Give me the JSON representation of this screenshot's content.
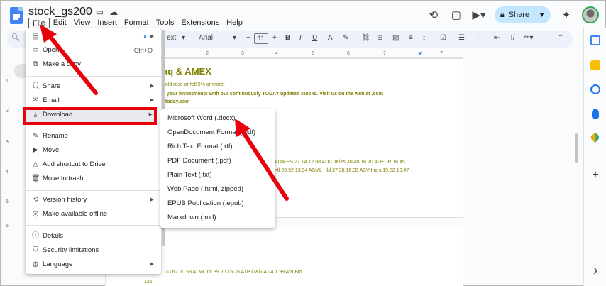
{
  "app": {
    "doc_title": "stock_gs200",
    "menus": [
      "File",
      "Edit",
      "View",
      "Insert",
      "Format",
      "Tools",
      "Extensions",
      "Help"
    ],
    "share_label": "Share"
  },
  "toolbar": {
    "style_label": "ext",
    "font_label": "Arial",
    "font_size": "11"
  },
  "ruler": {
    "numbers": [
      "1",
      "2",
      "3",
      "4",
      "5",
      "6",
      "7"
    ]
  },
  "vruler": {
    "numbers": [
      "1",
      "2",
      "3",
      "4",
      "5",
      "6",
      "7",
      "8",
      "9",
      "10"
    ]
  },
  "document": {
    "heading": "aq & AMEX",
    "line1": "bold rose or fell 5% or more.",
    "line2": "k your investments with our continuously TODAY updated stocks. Visit us on the web at .com",
    "line3": "atoday.com",
    "line4": "ADA-ES 27.14 12.88 ADC Tel rs 30.40 16.70 ADECP 16.45",
    "line5": "ntl 20.92 13.94 ASML Hld 27.38 16.39 ASV Inc s 19.82 10.47",
    "line6": "33.62 20.53 ATMI Inc 39.20 16.76 ATP O&G 4.24 1.99 AVI Bio",
    "page_number": "126"
  },
  "file_menu": {
    "items": [
      {
        "icon": "doc-icon",
        "label": "",
        "shortcut": "",
        "arrow": true
      },
      {
        "icon": "folder-open-icon",
        "label": "Open",
        "shortcut": "Ctrl+O",
        "arrow": false
      },
      {
        "icon": "copy-icon",
        "label": "Make a copy",
        "shortcut": "",
        "arrow": false
      },
      {
        "icon": "person-add-icon",
        "label": "Share",
        "shortcut": "",
        "arrow": true
      },
      {
        "icon": "mail-icon",
        "label": "Email",
        "shortcut": "",
        "arrow": true
      },
      {
        "icon": "download-icon",
        "label": "Download",
        "shortcut": "",
        "arrow": true
      },
      {
        "icon": "rename-icon",
        "label": "Rename",
        "shortcut": "",
        "arrow": false
      },
      {
        "icon": "move-icon",
        "label": "Move",
        "shortcut": "",
        "arrow": false
      },
      {
        "icon": "drive-shortcut-icon",
        "label": "Add shortcut to Drive",
        "shortcut": "",
        "arrow": false
      },
      {
        "icon": "trash-icon",
        "label": "Move to trash",
        "shortcut": "",
        "arrow": false
      },
      {
        "icon": "history-icon",
        "label": "Version history",
        "shortcut": "",
        "arrow": true
      },
      {
        "icon": "offline-icon",
        "label": "Make available offline",
        "shortcut": "",
        "arrow": false
      },
      {
        "icon": "info-icon",
        "label": "Details",
        "shortcut": "",
        "arrow": false
      },
      {
        "icon": "shield-icon",
        "label": "Security limitations",
        "shortcut": "",
        "arrow": false
      },
      {
        "icon": "globe-icon",
        "label": "Language",
        "shortcut": "",
        "arrow": true
      }
    ]
  },
  "download_menu": {
    "items": [
      "Microsoft Word (.docx)",
      "OpenDocument Format (.odt)",
      "Rich Text Format (.rtf)",
      "PDF Document (.pdf)",
      "Plain Text (.txt)",
      "Web Page (.html, zipped)",
      "EPUB Publication (.epub)",
      "Markdown (.md)"
    ]
  },
  "colors": {
    "annotation_red": "#e8000d",
    "doc_text": "#7f7f00",
    "accent_blue": "#4285f4",
    "share_bg": "#c2e7ff"
  }
}
